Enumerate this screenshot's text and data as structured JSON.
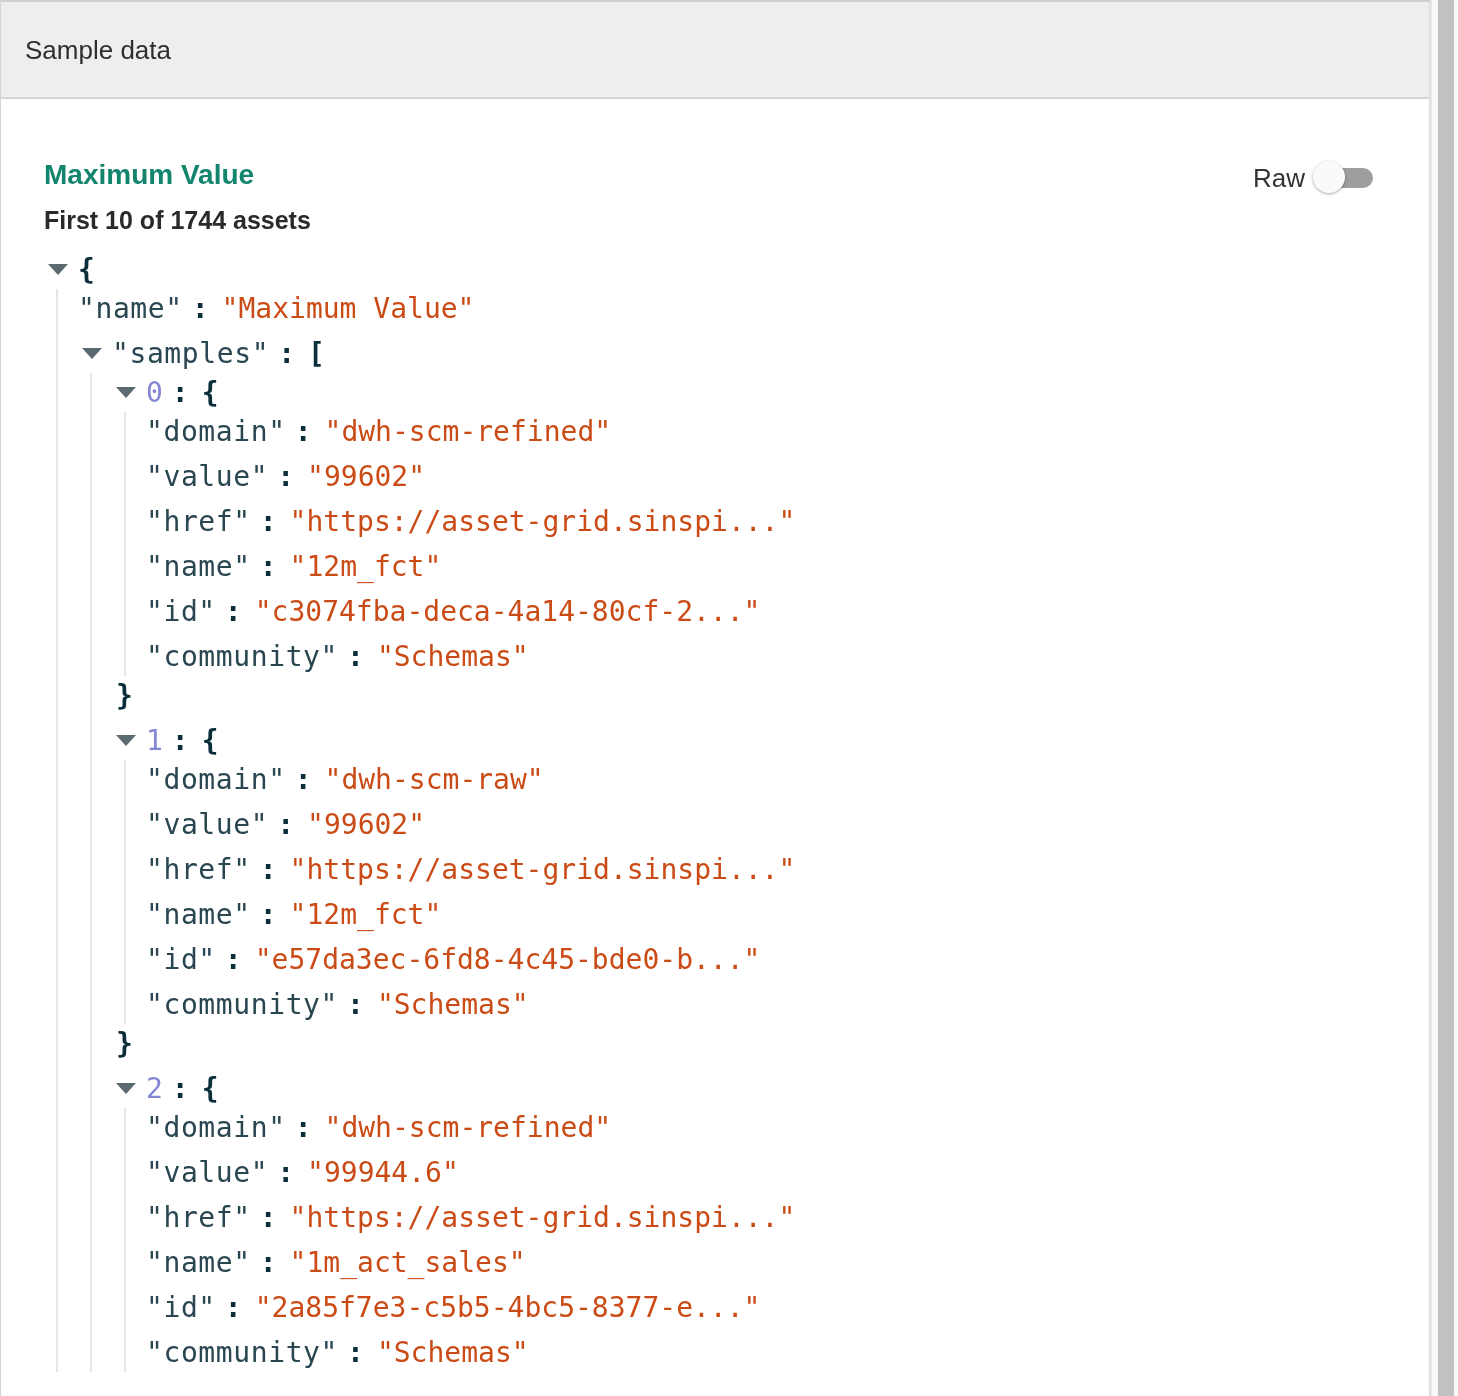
{
  "panel": {
    "title": "Sample data"
  },
  "heading": "Maximum Value",
  "subheading": "First 10 of 1744 assets",
  "raw_toggle": {
    "label": "Raw",
    "on": false
  },
  "tree": {
    "bracket": "{",
    "expanded": true,
    "children": [
      {
        "kind": "leaf",
        "key": "\"name\"",
        "separator": ":",
        "value": "\"Maximum Value\""
      },
      {
        "kind": "node",
        "key": "\"samples\"",
        "separator": ":",
        "bracket": "[",
        "expanded": true,
        "children": [
          {
            "kind": "node",
            "index": "0",
            "separator": ":",
            "bracket": "{",
            "expanded": true,
            "closing": "}",
            "children": [
              {
                "kind": "leaf",
                "key": "\"domain\"",
                "separator": ":",
                "value": "\"dwh-scm-refined\""
              },
              {
                "kind": "leaf",
                "key": "\"value\"",
                "separator": ":",
                "value": "\"99602\""
              },
              {
                "kind": "leaf",
                "key": "\"href\"",
                "separator": ":",
                "value": "\"https://asset-grid.sinspi...\""
              },
              {
                "kind": "leaf",
                "key": "\"name\"",
                "separator": ":",
                "value": "\"12m_fct\""
              },
              {
                "kind": "leaf",
                "key": "\"id\"",
                "separator": ":",
                "value": "\"c3074fba-deca-4a14-80cf-2...\""
              },
              {
                "kind": "leaf",
                "key": "\"community\"",
                "separator": ":",
                "value": "\"Schemas\""
              }
            ]
          },
          {
            "kind": "node",
            "index": "1",
            "separator": ":",
            "bracket": "{",
            "expanded": true,
            "closing": "}",
            "children": [
              {
                "kind": "leaf",
                "key": "\"domain\"",
                "separator": ":",
                "value": "\"dwh-scm-raw\""
              },
              {
                "kind": "leaf",
                "key": "\"value\"",
                "separator": ":",
                "value": "\"99602\""
              },
              {
                "kind": "leaf",
                "key": "\"href\"",
                "separator": ":",
                "value": "\"https://asset-grid.sinspi...\""
              },
              {
                "kind": "leaf",
                "key": "\"name\"",
                "separator": ":",
                "value": "\"12m_fct\""
              },
              {
                "kind": "leaf",
                "key": "\"id\"",
                "separator": ":",
                "value": "\"e57da3ec-6fd8-4c45-bde0-b...\""
              },
              {
                "kind": "leaf",
                "key": "\"community\"",
                "separator": ":",
                "value": "\"Schemas\""
              }
            ]
          },
          {
            "kind": "node",
            "index": "2",
            "separator": ":",
            "bracket": "{",
            "expanded": true,
            "children": [
              {
                "kind": "leaf",
                "key": "\"domain\"",
                "separator": ":",
                "value": "\"dwh-scm-refined\""
              },
              {
                "kind": "leaf",
                "key": "\"value\"",
                "separator": ":",
                "value": "\"99944.6\""
              },
              {
                "kind": "leaf",
                "key": "\"href\"",
                "separator": ":",
                "value": "\"https://asset-grid.sinspi...\""
              },
              {
                "kind": "leaf",
                "key": "\"name\"",
                "separator": ":",
                "value": "\"1m_act_sales\""
              },
              {
                "kind": "leaf",
                "key": "\"id\"",
                "separator": ":",
                "value": "\"2a85f7e3-c5b5-4bc5-8377-e...\""
              },
              {
                "kind": "leaf",
                "key": "\"community\"",
                "separator": ":",
                "value": "\"Schemas\""
              }
            ]
          }
        ]
      }
    ]
  }
}
